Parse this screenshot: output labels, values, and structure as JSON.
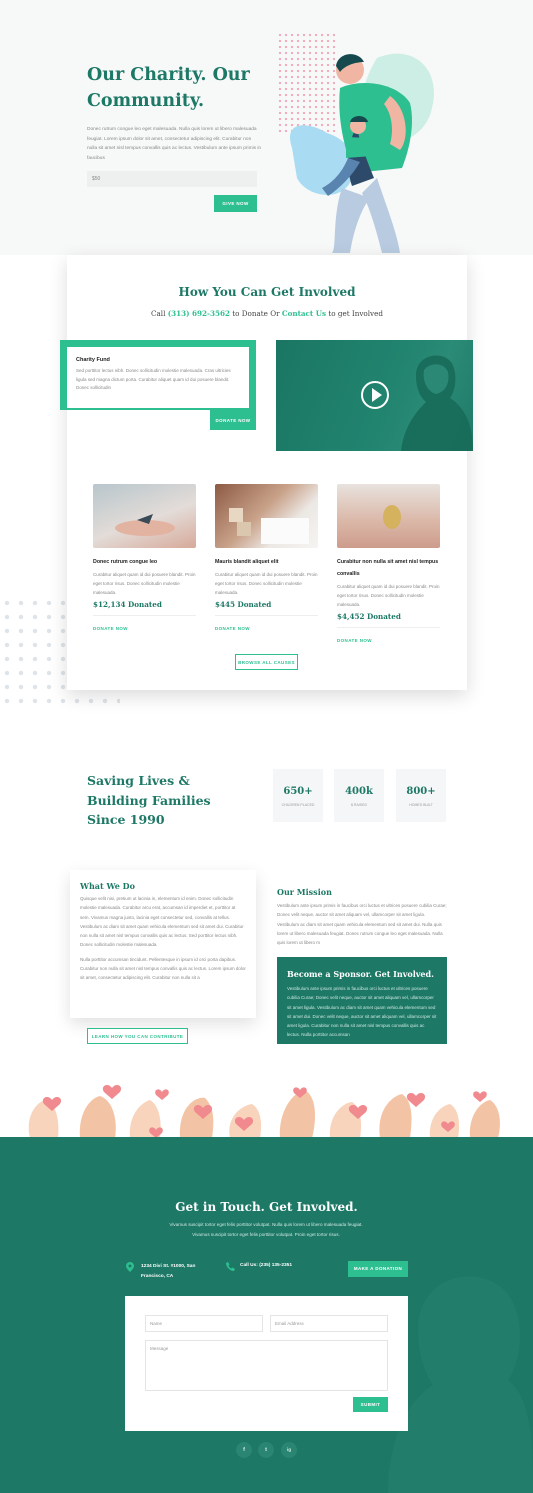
{
  "hero": {
    "title": "Our Charity. Our Community.",
    "text": "Donec rutrum congue leo eget malesuada. Nulla quis lorem ut libero malesuada feugiat. Lorem ipsum dolor sit amet, consectetur adipiscing elit. Curabitur non nulla sit amet nisl tempus convallis quis ac lectus. Vestibulum ante ipsum primis in faucibus",
    "amount_value": "$50",
    "give_button": "GIVE NOW"
  },
  "involved": {
    "title": "How You Can Get Involved",
    "sub_prefix": "Call ",
    "phone": "(313) 692-3562",
    "sub_middle": " to Donate Or ",
    "contact_link": "Contact Us",
    "sub_suffix": " to get Involved",
    "charity_fund": {
      "title": "Charity Fund",
      "text": "Sed porttitor lectus nibh. Donec sollicitudin molestie malesuada. Cras ultricies ligula sed magna dictum porta. Curabitur aliquet quam id dui posuere blandit. Donec sollicitudin",
      "button": "DONATE NOW"
    },
    "causes": [
      {
        "title": "Donec rutrum congue leo",
        "text": "Curabitur aliquet quam id dui posuere blandit. Proin eget tortor risus. Donec sollicitudin molestie malesuada.",
        "amount": "$12,134 Donated",
        "link": "DONATE NOW"
      },
      {
        "title": "Mauris blandit aliquet elit",
        "text": "Curabitur aliquet quam id dui posuere blandit. Proin eget tortor risus. Donec sollicitudin molestie malesuada.",
        "amount": "$445 Donated",
        "link": "DONATE NOW"
      },
      {
        "title": "Curabitur non nulla sit amet nisl tempus convallis",
        "text": "Curabitur aliquet quam id dui posuere blandit. Proin eget tortor risus. Donec sollicitudin molestie malesuada.",
        "amount": "$4,452 Donated",
        "link": "DONATE NOW"
      }
    ],
    "browse_button": "BROWSE ALL CAUSES"
  },
  "saving": {
    "title": "Saving Lives & Building Families Since 1990",
    "stats": [
      {
        "number": "650+",
        "label": "CHILDREN PLACED"
      },
      {
        "number": "400k",
        "label": "$ RAISED"
      },
      {
        "number": "800+",
        "label": "HOMES BUILT"
      }
    ]
  },
  "what_we_do": {
    "title": "What We Do",
    "p1": "Quisque velit nisi, pretium ut lacinia in, elementum id enim. Donec sollicitudin molestie malesuada. Curabitur arcu erat, accumsan id imperdiet et, porttitor at sem. Vivamus magna justo, lacinia eget consectetur sed, convallis at tellus. Vestibulum ac diam sit amet quam vehicula elementum sed sit amet dui. Curabitur non nulla sit amet nisl tempus convallis quis ac lectus. Sed porttitor lectus nibh. Donec sollicitudin molestie malesuada.",
    "p2": "Nulla porttitor accumsan tincidunt. Pellentesque in ipsum id orci porta dapibus. Curabitur non nulla sit amet nisl tempus convallis quis ac lectus. Lorem ipsum dolor sit amet, consectetur adipiscing elit. Curabitur non nulla sit a",
    "button": "LEARN HOW YOU CAN CONTRIBUTE"
  },
  "mission": {
    "title": "Our Mission",
    "text": "Vestibulum ante ipsum primis in faucibus orci luctus et ultrices posuere cubilia Curae; Donec velit neque, auctor sit amet aliquam vel, ullamcorper sit amet ligula. Vestibulum ac diam sit amet quam vehicula elementum sed sit amet dui. Nulla quis lorem ut libero malesuada feugiat. Donec rutrum congue leo eget malesuada. Nulla quis lorem ut libero m"
  },
  "sponsor": {
    "title": "Become a Sponsor. Get Involved.",
    "text": "Vestibulum ante ipsum primis in faucibus orci luctus et ultrices posuere cubilia Curae; Donec velit neque, auctor sit amet aliquam vel, ullamcorper sit amet ligula. Vestibulum ac diam sit amet quam vehicula elementum sed sit amet dui. Donec velit neque, auctor sit amet aliquam vel, ullamcorper sit amet ligula. Curabitur non nulla sit amet nisl tempus convallis quis ac lectus. Nulla porttitor accumsan"
  },
  "contact": {
    "title": "Get in Touch. Get Involved.",
    "text": "Vivamus suscipit tortor eget felis porttitor volutpat. Nulla quis lorem ut libero malesuada feugiat. Vivamus suscipit tortor eget felis porttitor volutpat. Proin eget tortor risus.",
    "address": "1234 Divi St. #1000, San Francisco, CA",
    "phone": "Call Us: (235) 135-2351",
    "donation_button": "MAKE A DONATION",
    "form": {
      "name_placeholder": "Name",
      "email_placeholder": "Email Address",
      "message_placeholder": "Message",
      "submit": "SUBMIT"
    },
    "social": [
      "f",
      "t",
      "ig"
    ]
  },
  "colors": {
    "primary": "#1d7866",
    "accent": "#2ebf91"
  }
}
